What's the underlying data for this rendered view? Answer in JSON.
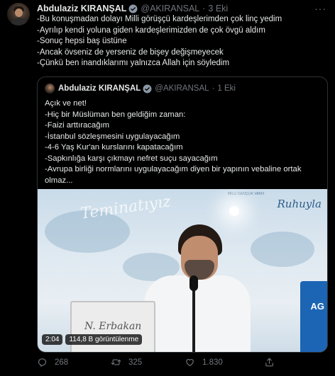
{
  "tweet": {
    "author": {
      "name": "Abdulaziz KIRANŞAL",
      "handle": "@AKIRANSAL",
      "separator": "·",
      "time": "3 Eki"
    },
    "more_icon": "more-dots-icon",
    "body_lines": [
      "-Bu konuşmadan dolayı Milli görüşçü kardeşlerimden çok linç yedim",
      "-Ayrılıp kendi yoluna giden kardeşlerimizden de çok övgü aldım",
      "-Sonuç hepsi baş üstüne",
      "-Ancak övseniz de yerseniz de bişey değişmeyecek",
      "-Çünkü ben inandıklarımı yalnızca Allah için söyledim"
    ],
    "quoted": {
      "author": {
        "name": "Abdulaziz KIRANŞAL",
        "handle": "@AKIRANSAL",
        "separator": "·",
        "time": "1 Eki"
      },
      "text_lines": [
        "Açık ve net!",
        "-Hiç bir Müslüman ben geldiğim zaman:",
        "-Faizi arttıracağım",
        "-İstanbul sözleşmesini uygulayacağım",
        "-4-6 Yaş Kur'an kurslarını kapatacağım",
        "-Sapkınlığa karşı çıkmayı nefret suçu sayacağım",
        "-Avrupa birliği normlarını uygulayacağım diyen bir yapının vebaline ortak",
        "olmaz..."
      ],
      "video": {
        "duration": "2:04",
        "views": "114,8 B görüntülenme",
        "watermark_left": "Teminatıyız",
        "watermark_right": "Ruhuyla",
        "watermark_small": "MİLLİ GENÇLİK VAKFI",
        "flag_text": "AG",
        "laptop_signature": "N. Erbakan"
      }
    },
    "actions": {
      "reply_count": "268",
      "retweet_count": "325",
      "like_count": "1.830",
      "colors": {
        "muted": "#71767b",
        "verified": "#8b98a5"
      }
    }
  }
}
